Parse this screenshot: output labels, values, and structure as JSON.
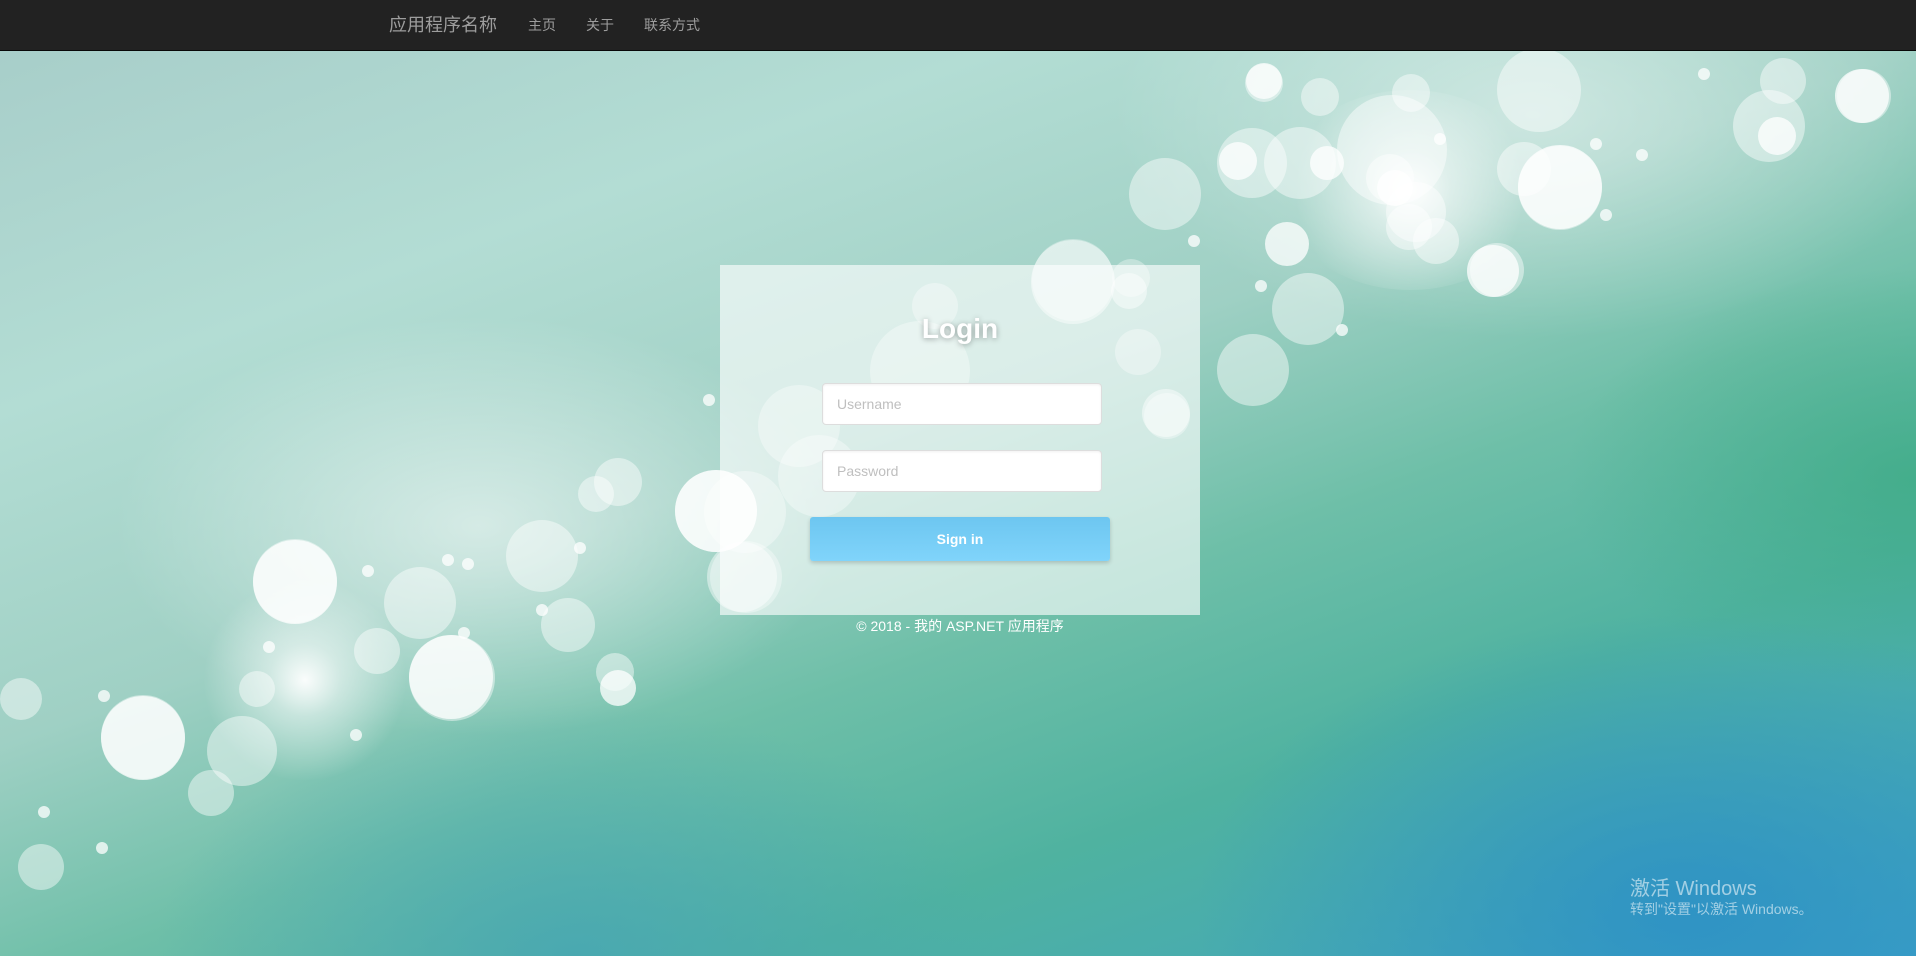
{
  "navbar": {
    "brand": "应用程序名称",
    "links": [
      "主页",
      "关于",
      "联系方式"
    ]
  },
  "login": {
    "title": "Login",
    "username_placeholder": "Username",
    "password_placeholder": "Password",
    "signin_label": "Sign in"
  },
  "footer": {
    "text": "© 2018 - 我的 ASP.NET 应用程序"
  },
  "watermark": {
    "title": "激活 Windows",
    "subtitle": "转到\"设置\"以激活 Windows。"
  },
  "colors": {
    "navbar": "#222222",
    "nav_text": "#9d9d9d",
    "signin_button": "#79cff8"
  }
}
